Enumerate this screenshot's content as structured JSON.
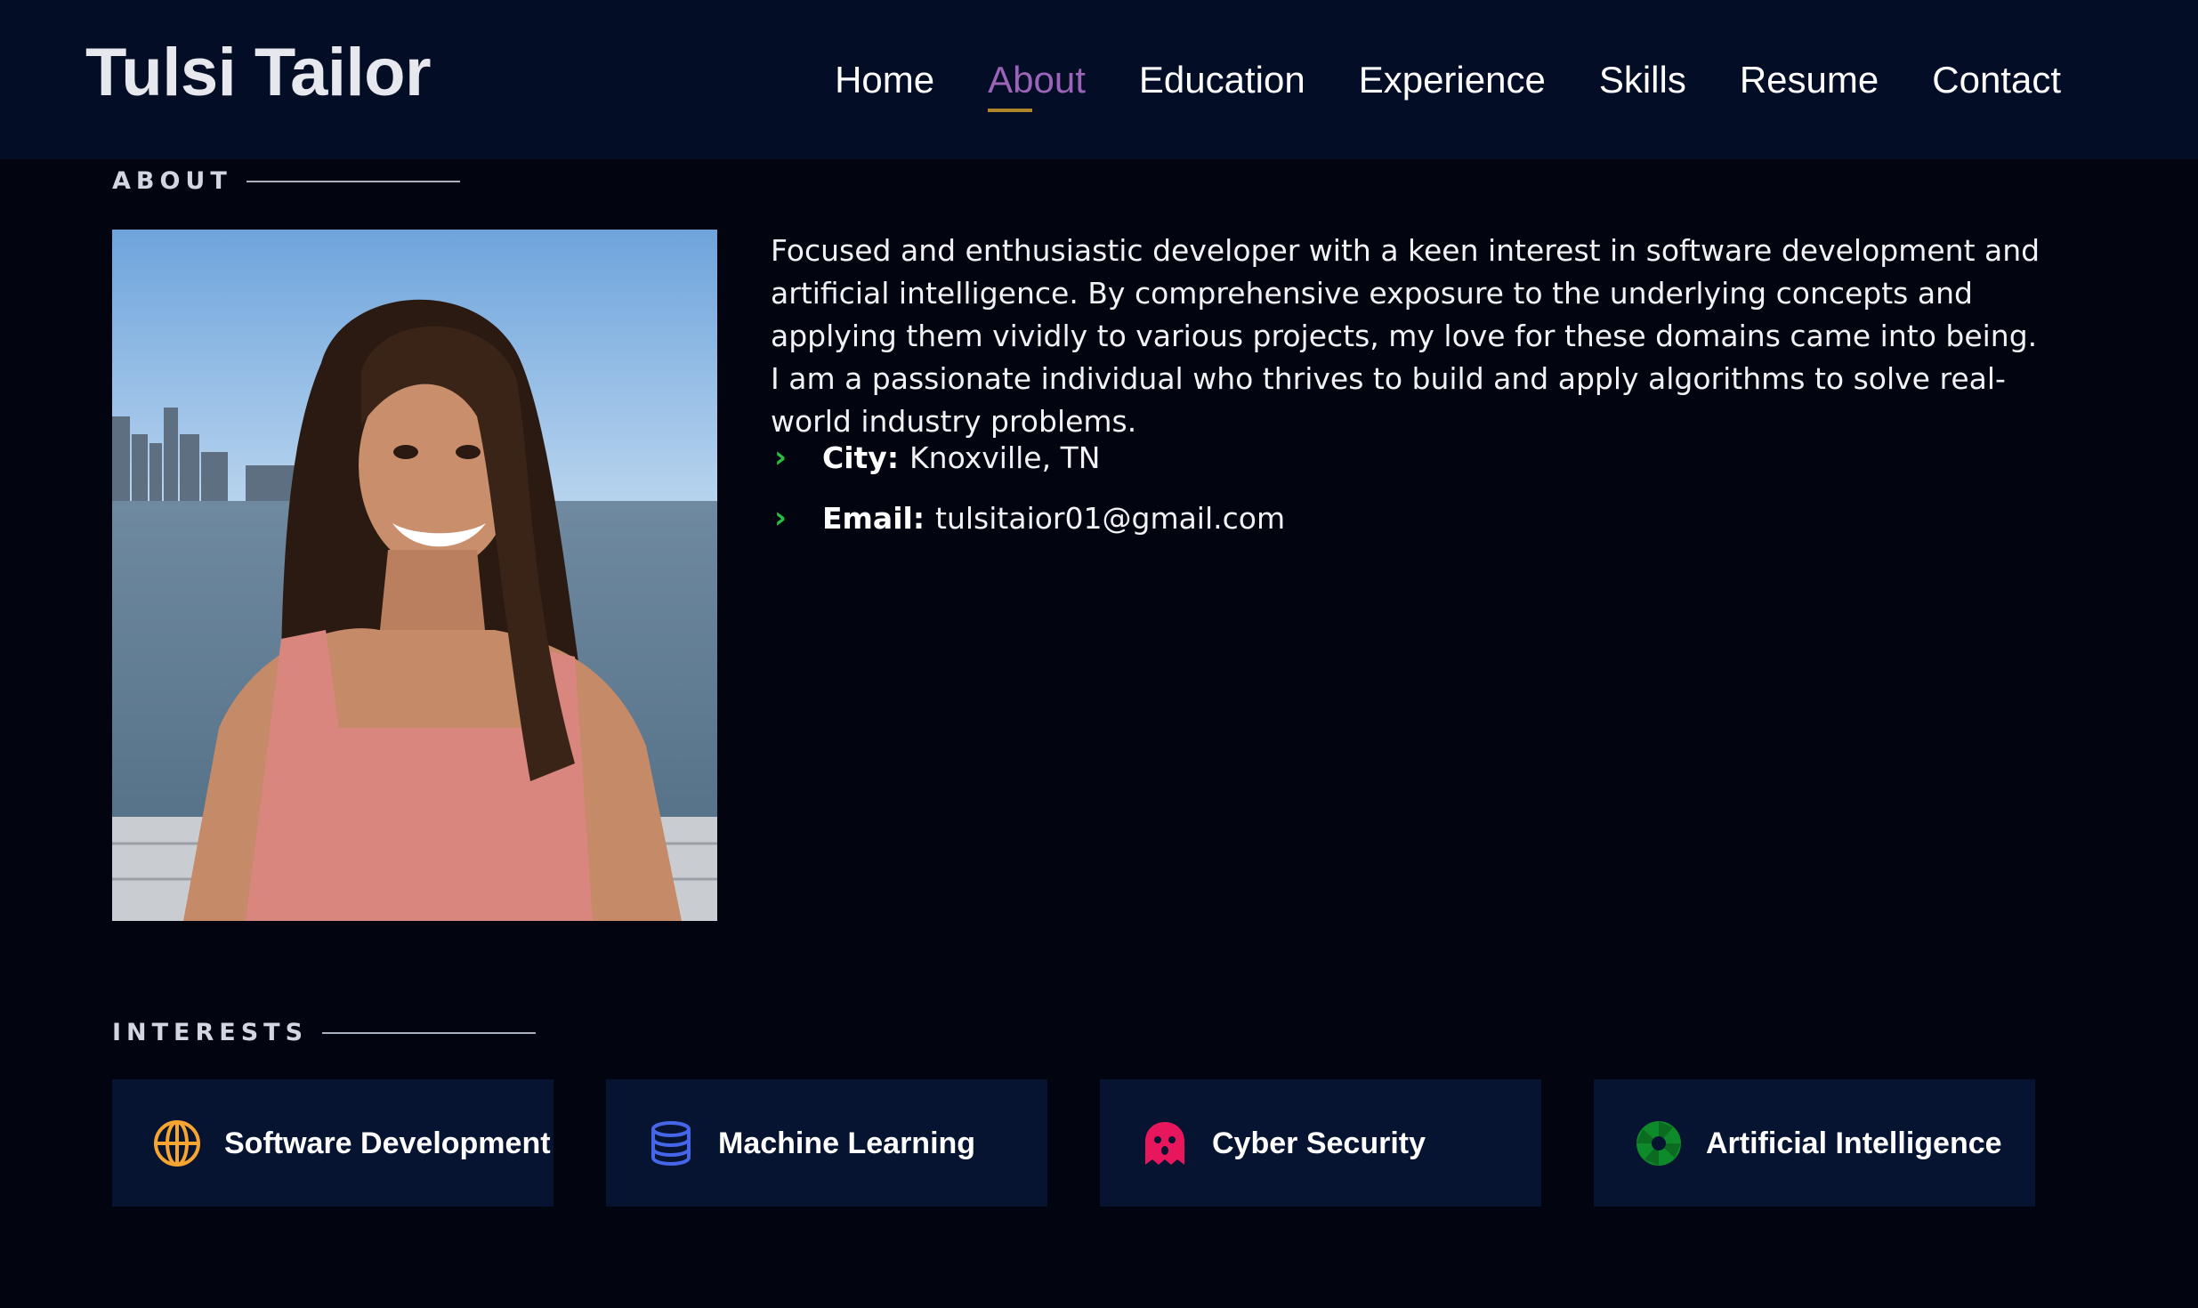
{
  "header": {
    "brand": "Tulsi Tailor",
    "nav": [
      {
        "label": "Home",
        "active": false
      },
      {
        "label": "About",
        "active": true
      },
      {
        "label": "Education",
        "active": false
      },
      {
        "label": "Experience",
        "active": false
      },
      {
        "label": "Skills",
        "active": false
      },
      {
        "label": "Resume",
        "active": false
      },
      {
        "label": "Contact",
        "active": false
      }
    ]
  },
  "about": {
    "section_title": "ABOUT",
    "bio": "Focused and enthusiastic developer with a keen interest in software development and artificial intelligence. By comprehensive exposure to the underlying concepts and applying them vividly to various projects, my love for these domains came into being. I am a passionate individual who thrives to build and apply algorithms to solve real-world industry problems.",
    "facts": [
      {
        "label": "City:",
        "value": "Knoxville, TN"
      },
      {
        "label": "Email:",
        "value": "tulsitaior01@gmail.com"
      }
    ]
  },
  "interests": {
    "section_title": "INTERESTS",
    "items": [
      {
        "label": "Software Development",
        "icon": "globe-icon",
        "color": "#f7a531"
      },
      {
        "label": "Machine Learning",
        "icon": "database-icon",
        "color": "#4566e8"
      },
      {
        "label": "Cyber Security",
        "icon": "ghost-icon",
        "color": "#e8175d"
      },
      {
        "label": "Artificial Intelligence",
        "icon": "aperture-icon",
        "color": "#0f8a2a"
      }
    ]
  },
  "colors": {
    "header_bg": "#040d26",
    "page_bg": "#020510",
    "nav_active": "#9c64b8",
    "nav_underline": "#b0862a",
    "chevron": "#25c23f",
    "card_bg": "#061331"
  }
}
